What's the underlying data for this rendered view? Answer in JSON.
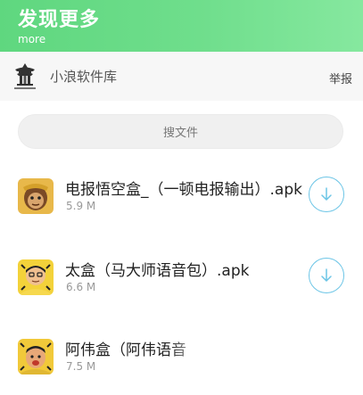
{
  "header": {
    "title": "发现更多",
    "subtitle": "more",
    "background_color": "#6fde8c"
  },
  "source": {
    "name": "小浪软件库",
    "report_label": "举报",
    "logo_icon": "temple-logo-icon"
  },
  "search": {
    "placeholder": "搜文件"
  },
  "files": [
    {
      "name": "电报悟空盒_（一顿电报输出）.apk",
      "size": "5.9 M",
      "thumb_icon": "monkey-king-thumb-icon"
    },
    {
      "name": "太盒（马大师语音包）.apk",
      "size": "6.6 M",
      "thumb_icon": "master-ma-thumb-icon"
    },
    {
      "name": "阿伟盒（阿伟语音",
      "size": "7.5 M",
      "thumb_icon": "a-wei-thumb-icon"
    }
  ],
  "colors": {
    "download_accent": "#6cc5e6"
  }
}
